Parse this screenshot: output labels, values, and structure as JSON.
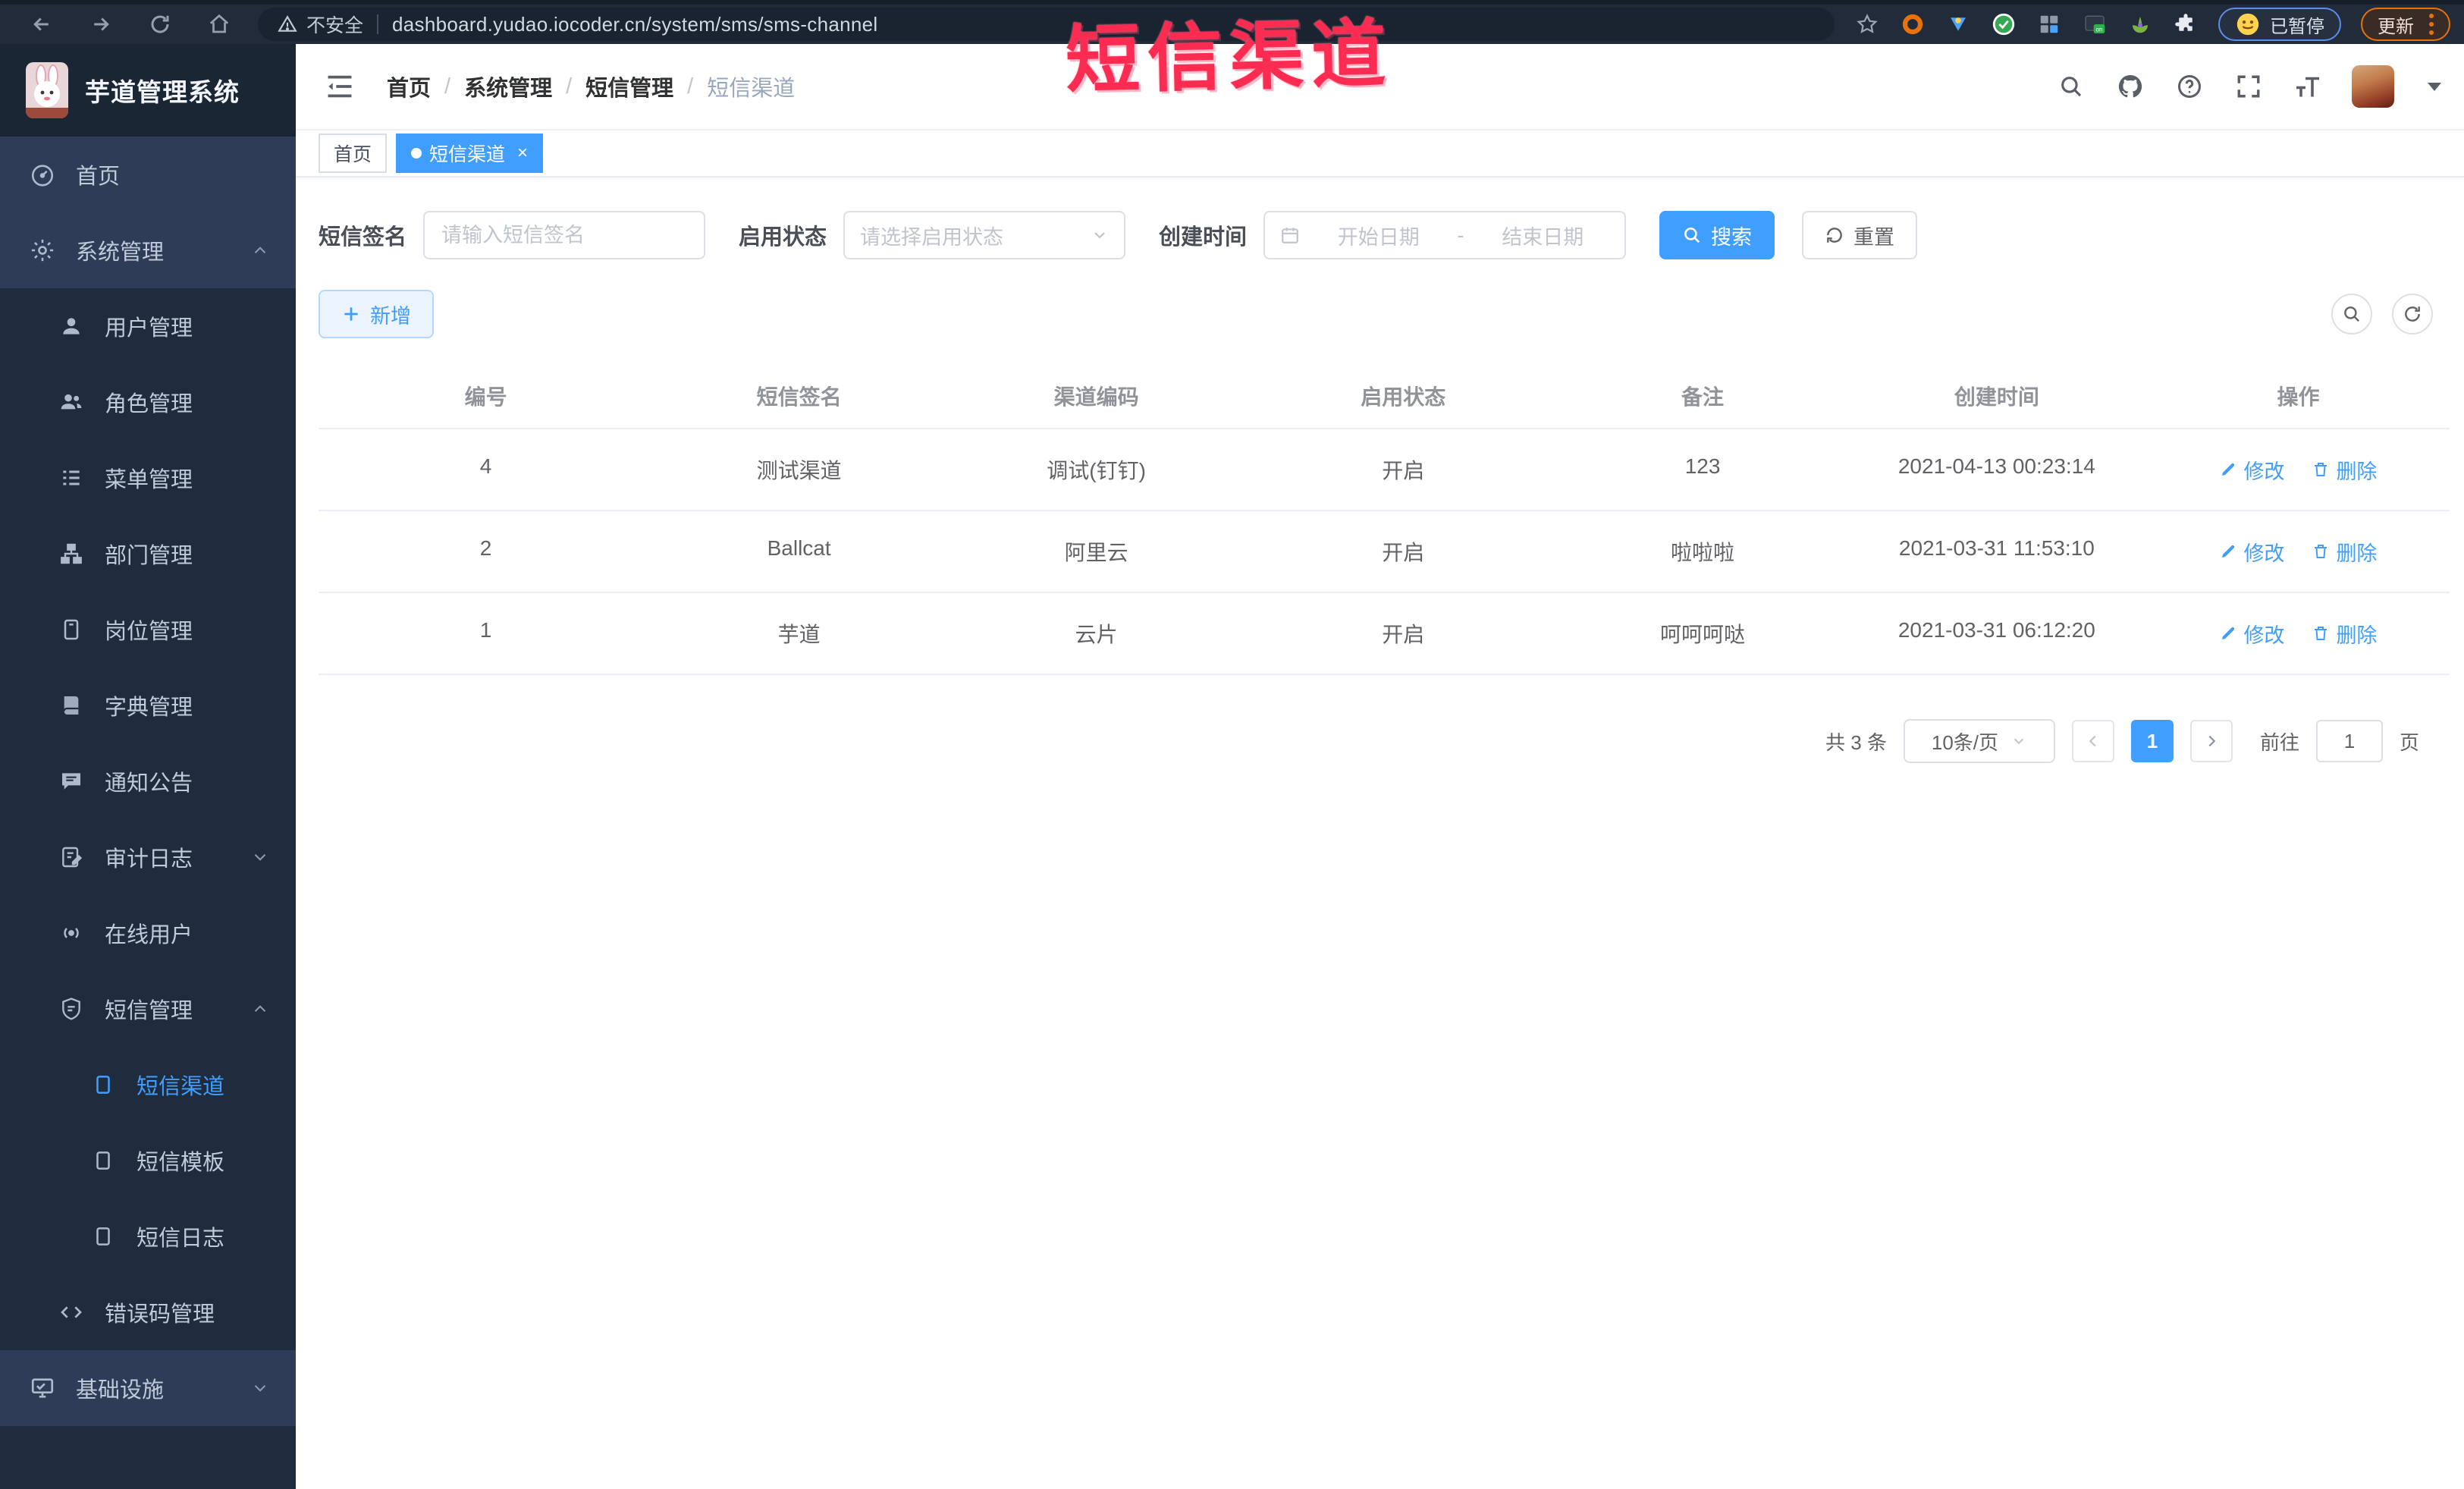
{
  "browser": {
    "security_label": "不安全",
    "url": "dashboard.yudao.iocoder.cn/system/sms/sms-channel",
    "paused_label": "已暂停",
    "update_label": "更新"
  },
  "annotation": {
    "text": "短信渠道"
  },
  "app": {
    "title": "芋道管理系统"
  },
  "sidebar": {
    "items": [
      {
        "label": "首页"
      },
      {
        "label": "系统管理"
      },
      {
        "label": "用户管理"
      },
      {
        "label": "角色管理"
      },
      {
        "label": "菜单管理"
      },
      {
        "label": "部门管理"
      },
      {
        "label": "岗位管理"
      },
      {
        "label": "字典管理"
      },
      {
        "label": "通知公告"
      },
      {
        "label": "审计日志"
      },
      {
        "label": "在线用户"
      },
      {
        "label": "短信管理"
      },
      {
        "label": "短信渠道"
      },
      {
        "label": "短信模板"
      },
      {
        "label": "短信日志"
      },
      {
        "label": "错误码管理"
      },
      {
        "label": "基础设施"
      }
    ]
  },
  "breadcrumb": {
    "items": [
      "首页",
      "系统管理",
      "短信管理",
      "短信渠道"
    ],
    "separator": "/"
  },
  "tags": {
    "home": "首页",
    "active": "短信渠道",
    "close": "×"
  },
  "search_form": {
    "sign_label": "短信签名",
    "sign_placeholder": "请输入短信签名",
    "status_label": "启用状态",
    "status_placeholder": "请选择启用状态",
    "time_label": "创建时间",
    "start_placeholder": "开始日期",
    "range_separator": "-",
    "end_placeholder": "结束日期",
    "search_label": "搜索",
    "reset_label": "重置"
  },
  "toolbar": {
    "add_label": "新增"
  },
  "table": {
    "columns": [
      "编号",
      "短信签名",
      "渠道编码",
      "启用状态",
      "备注",
      "创建时间",
      "操作"
    ],
    "edit_label": "修改",
    "delete_label": "删除",
    "rows": [
      {
        "id": "4",
        "sign": "测试渠道",
        "code": "调试(钉钉)",
        "status": "开启",
        "remark": "123",
        "created": "2021-04-13 00:23:14"
      },
      {
        "id": "2",
        "sign": "Ballcat",
        "code": "阿里云",
        "status": "开启",
        "remark": "啦啦啦",
        "created": "2021-03-31 11:53:10"
      },
      {
        "id": "1",
        "sign": "芋道",
        "code": "云片",
        "status": "开启",
        "remark": "呵呵呵哒",
        "created": "2021-03-31 06:12:20"
      }
    ]
  },
  "pagination": {
    "total": "共 3 条",
    "page_size": "10条/页",
    "page": "1",
    "goto_label": "前往",
    "goto_value": "1",
    "page_unit": "页"
  },
  "colors": {
    "accent": "#409eff",
    "annotation": "#fb2b51",
    "active_tag": "#409eff"
  }
}
